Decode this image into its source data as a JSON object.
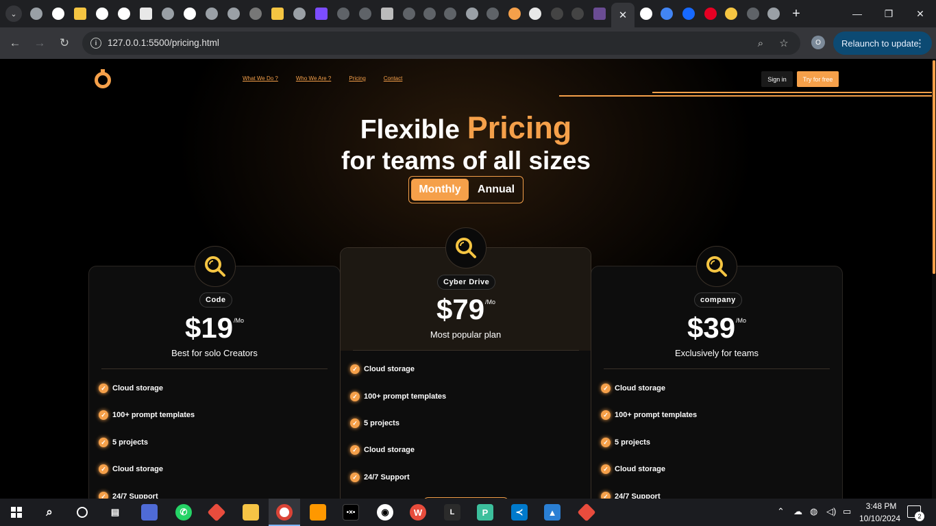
{
  "browser": {
    "active_tab_close": "✕",
    "new_tab": "+",
    "url": "127.0.0.1:5500/pricing.html",
    "profile_initial": "O",
    "relaunch_label": "Relaunch to update"
  },
  "nav": {
    "links": [
      "What We Do ?",
      "Who We Are ?",
      "Pricing",
      "Contact"
    ],
    "sign_in": "Sign in",
    "try_free": "Try for free"
  },
  "hero": {
    "line1_prefix": "Flexible",
    "line1_accent": "Pricing",
    "line2": "for teams of all sizes"
  },
  "billing_toggle": {
    "monthly": "Monthly",
    "annual": "Annual",
    "selected": "Monthly"
  },
  "plans": [
    {
      "name": "Code",
      "price": "$19",
      "unit": "/Mo",
      "tagline": "Best for solo Creators",
      "features": [
        "Cloud storage",
        "100+ prompt templates",
        "5 projects",
        "Cloud storage",
        "24/7 Support"
      ]
    },
    {
      "name": "Cyber Drive",
      "price": "$79",
      "unit": "/Mo",
      "tagline": "Most popular plan",
      "features": [
        "Cloud storage",
        "100+ prompt templates",
        "5 projects",
        "Cloud storage",
        "24/7 Support"
      ]
    },
    {
      "name": "company",
      "price": "$39",
      "unit": "/Mo",
      "tagline": "Exclusively for teams",
      "features": [
        "Cloud storage",
        "100+ prompt templates",
        "5 projects",
        "Cloud storage",
        "24/7 Support"
      ]
    }
  ],
  "colors": {
    "accent": "#f5a04a",
    "background": "#000000",
    "card": "#0d0d0d"
  },
  "taskbar": {
    "time": "3:48 PM",
    "date": "10/10/2024",
    "notifications": "2"
  }
}
